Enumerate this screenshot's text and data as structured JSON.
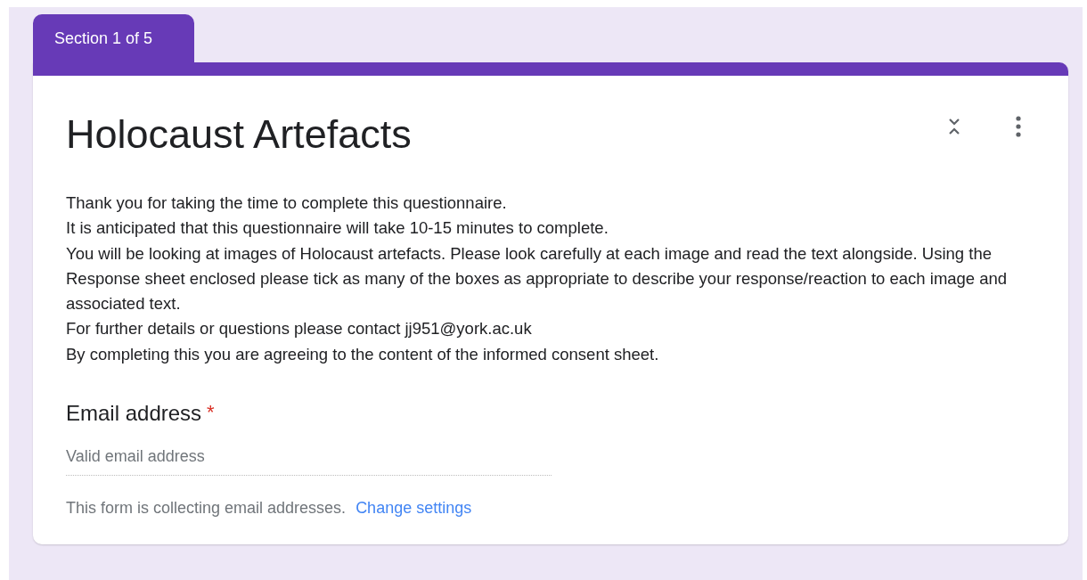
{
  "section_tab": {
    "label": "Section 1 of 5"
  },
  "section": {
    "title": "Holocaust Artefacts",
    "description": [
      "Thank you for taking the time to complete this questionnaire.",
      "It is anticipated that this questionnaire will take 10-15 minutes to complete.",
      "You will be looking at images of Holocaust artefacts. Please look carefully at each image and read the text alongside. Using the Response sheet enclosed please tick as many of the boxes as appropriate to describe your response/reaction to each image and associated text.",
      "For further details or questions please contact jj951@york.ac.uk",
      "By completing this you are agreeing to the content of the informed consent sheet."
    ]
  },
  "question": {
    "label": "Email address",
    "required": true,
    "required_mark": "*",
    "placeholder": "Valid email address"
  },
  "notice": {
    "text": "This form is collecting email addresses.",
    "link": "Change settings"
  }
}
